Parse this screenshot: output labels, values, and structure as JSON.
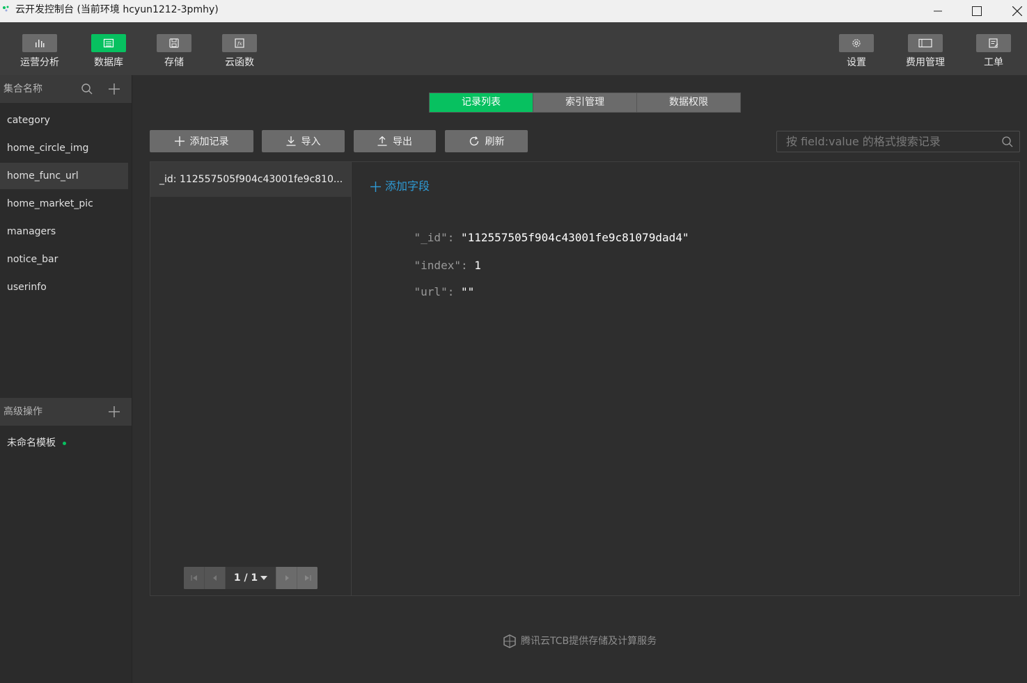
{
  "window": {
    "title": "云开发控制台 (当前环境 hcyun1212-3pmhy)"
  },
  "toolbar": {
    "left": [
      {
        "label": "运营分析",
        "icon": "bar-chart-icon",
        "active": false
      },
      {
        "label": "数据库",
        "icon": "database-icon",
        "active": true
      },
      {
        "label": "存储",
        "icon": "storage-icon",
        "active": false
      },
      {
        "label": "云函数",
        "icon": "function-icon",
        "active": false
      }
    ],
    "right": [
      {
        "label": "设置",
        "icon": "gear-icon"
      },
      {
        "label": "费用管理",
        "icon": "billing-icon"
      },
      {
        "label": "工单",
        "icon": "ticket-icon"
      }
    ]
  },
  "sidebar": {
    "collections_header": "集合名称",
    "collections": [
      "category",
      "home_circle_img",
      "home_func_url",
      "home_market_pic",
      "managers",
      "notice_bar",
      "userinfo"
    ],
    "selected_collection": "home_func_url",
    "advanced_header": "高级操作",
    "template_name": "未命名模板"
  },
  "tabs": [
    {
      "label": "记录列表",
      "active": true
    },
    {
      "label": "索引管理",
      "active": false
    },
    {
      "label": "数据权限",
      "active": false
    }
  ],
  "actions": {
    "add_record": "添加记录",
    "import": "导入",
    "export": "导出",
    "refresh": "刷新"
  },
  "search": {
    "placeholder": "按 field:value 的格式搜索记录"
  },
  "records": {
    "items": [
      "_id: 112557505f904c43001fe9c810..."
    ],
    "pager": "1 / 1"
  },
  "detail": {
    "add_field": "添加字段",
    "fields": [
      {
        "key": "\"_id\"",
        "value": "\"112557505f904c43001fe9c81079dad4\""
      },
      {
        "key": "\"index\"",
        "value": "1"
      },
      {
        "key": "\"url\"",
        "value": "\"\""
      }
    ]
  },
  "footer": {
    "text": "腾讯云TCB提供存储及计算服务"
  },
  "colors": {
    "accent": "#07c160",
    "link": "#2e9bd6",
    "background": "#2e2e2e",
    "toolbar": "#3d3d3d"
  }
}
